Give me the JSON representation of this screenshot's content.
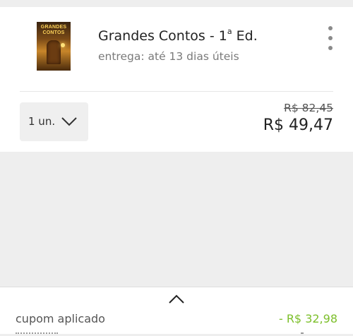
{
  "product": {
    "cover_text": "GRANDES CONTOS",
    "title_main": "Grandes Contos - 1",
    "title_sup": "a",
    "title_end": " Ed.",
    "delivery": "entrega: até 13 dias úteis",
    "more_icon": "kebab-menu-icon"
  },
  "quantity": {
    "label": "1 un.",
    "icon": "chevron-down-icon"
  },
  "pricing": {
    "old_price": "R$ 82,45",
    "price": "R$ 49,47"
  },
  "summary": {
    "expand_icon": "chevron-up-icon",
    "coupon_label": "cupom aplicado",
    "coupon_value": "- R$ 32,98"
  },
  "colors": {
    "discount_green": "#7cbf2a",
    "background": "#eeeeee",
    "card": "#ffffff"
  }
}
